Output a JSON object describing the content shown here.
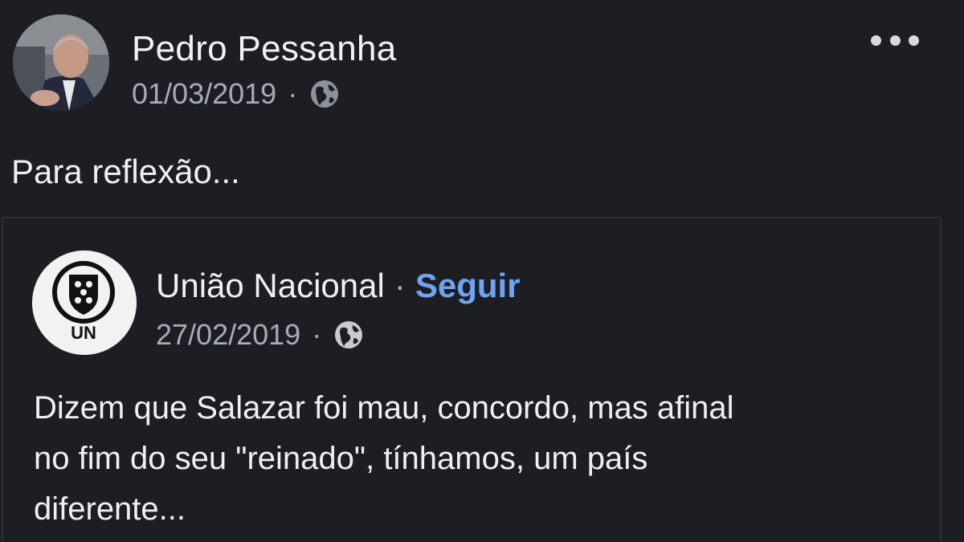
{
  "post": {
    "author": "Pedro Pessanha",
    "date": "01/03/2019",
    "separator": "·",
    "text": "Para reflexão...",
    "privacy_icon": "globe-icon",
    "more_icon": "more-options-icon"
  },
  "shared_post": {
    "page_name": "União Nacional",
    "separator": "·",
    "follow_label": "Seguir",
    "date": "27/02/2019",
    "logo_text": "UN",
    "privacy_icon": "globe-icon",
    "text_lines": [
      "Dizem que Salazar foi mau, concordo, mas afinal",
      "no fim do seu \"reinado\", tínhamos, um país",
      "diferente..."
    ]
  },
  "colors": {
    "background": "#1c1e23",
    "text": "#eef0f3",
    "muted": "#a8adb5",
    "link": "#6ea4f0",
    "border": "#2c2f36"
  }
}
